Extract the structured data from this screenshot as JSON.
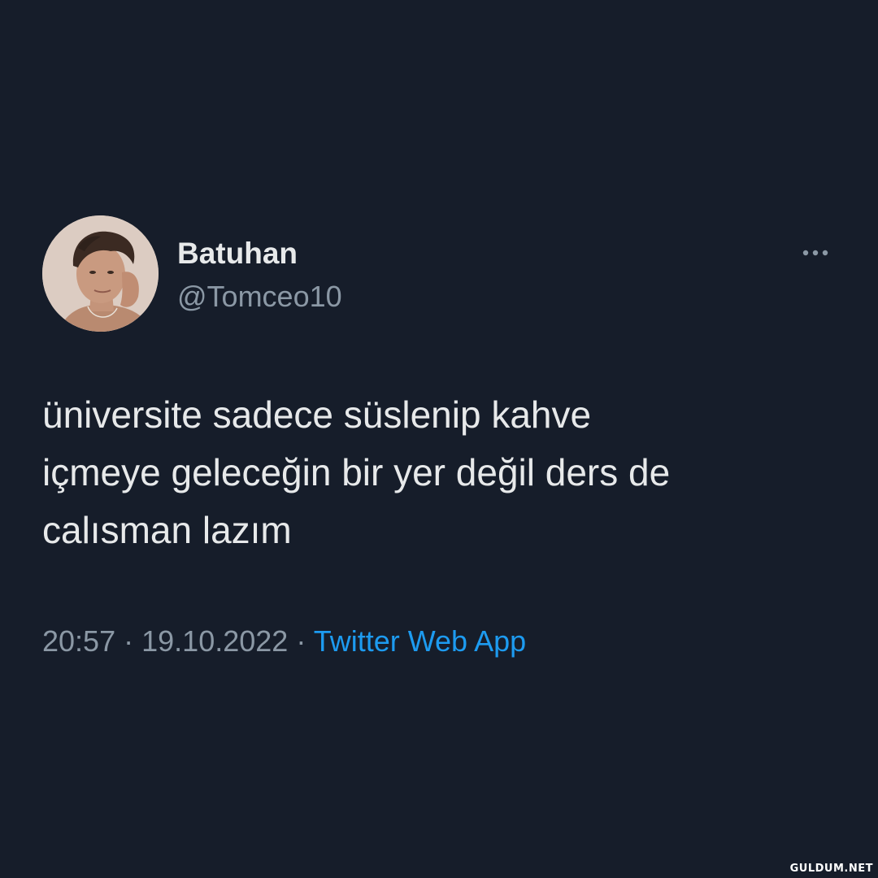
{
  "tweet": {
    "display_name": "Batuhan",
    "handle": "@Tomceo10",
    "text_lines": [
      "üniversite sadece süslenip kahve",
      "içmeye geleceğin bir yer değil ders de",
      "calısman lazım"
    ],
    "time": "20:57",
    "separator": "·",
    "date": "19.10.2022",
    "source": "Twitter Web App"
  },
  "icons": {
    "more": "more-horizontal-icon",
    "avatar": "profile-photo"
  },
  "watermark": "GULDUM.NET",
  "colors": {
    "background": "#161d2a",
    "text": "#e7e9ea",
    "muted": "#8b98a5",
    "link": "#1d9bf0"
  }
}
